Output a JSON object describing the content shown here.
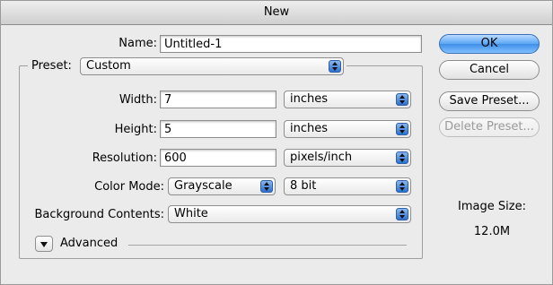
{
  "window": {
    "title": "New"
  },
  "form": {
    "name_label": "Name:",
    "name_value": "Untitled-1",
    "preset_label": "Preset:",
    "preset_value": "Custom",
    "width_label": "Width:",
    "width_value": "7",
    "width_unit": "inches",
    "height_label": "Height:",
    "height_value": "5",
    "height_unit": "inches",
    "resolution_label": "Resolution:",
    "resolution_value": "600",
    "resolution_unit": "pixels/inch",
    "color_mode_label": "Color Mode:",
    "color_mode_value": "Grayscale",
    "bit_depth_value": "8 bit",
    "background_label": "Background Contents:",
    "background_value": "White",
    "advanced_label": "Advanced"
  },
  "buttons": {
    "ok": "OK",
    "cancel": "Cancel",
    "save_preset": "Save Preset...",
    "delete_preset": "Delete Preset..."
  },
  "image_size": {
    "label": "Image Size:",
    "value": "12.0M"
  },
  "icons": {
    "popup_arrow": "updown-arrows-icon",
    "disclosure": "disclosure-triangle-icon"
  },
  "colors": {
    "default_button": "#5aa6f5",
    "window_bg": "#ebebeb"
  }
}
